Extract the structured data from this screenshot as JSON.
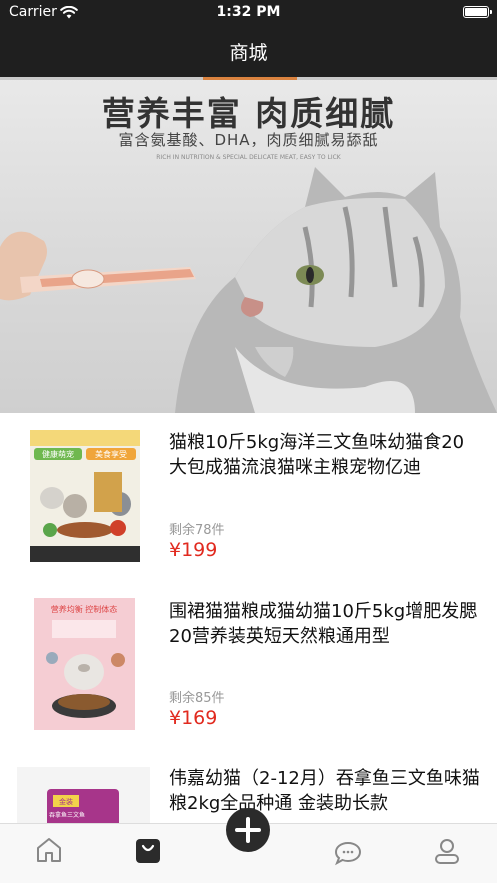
{
  "status_bar": {
    "carrier": "Carrier",
    "time": "1:32 PM"
  },
  "nav": {
    "title": "商城"
  },
  "banner": {
    "headline": "营养丰富 肉质细腻",
    "subheadline": "富含氨基酸、DHA，肉质细腻易舔舐",
    "fine_print": "RICH IN NUTRITION & SPECIAL DELICATE MEAT, EASY TO LICK",
    "pager": {
      "count": 2,
      "active": 0
    }
  },
  "products": [
    {
      "name": "猫粮10斤5kg海洋三文鱼味幼猫食20大包成猫流浪猫咪主粮宠物亿迪",
      "stock": "剩余78件",
      "price": "¥199",
      "thumb_text_1": "健康萌宠",
      "thumb_text_2": "美食享受"
    },
    {
      "name": "围裙猫猫粮成猫幼猫10斤5kg增肥发腮20营养装英短天然粮通用型",
      "stock": "剩余85件",
      "price": "¥169",
      "thumb_text_1": "营养均衡 控制体态"
    },
    {
      "name": "伟嘉幼猫（2-12月）吞拿鱼三文鱼味猫粮2kg全品种通 金装助长款",
      "thumb_text_1": "金装",
      "thumb_text_2": "吞拿鱼三文鱼"
    }
  ],
  "tabbar": {
    "tabs": [
      {
        "icon": "home-icon",
        "active": false
      },
      {
        "icon": "shop-bag-icon",
        "active": true
      },
      {
        "icon": "plus-icon"
      },
      {
        "icon": "chat-bubble-icon",
        "active": false
      },
      {
        "icon": "user-icon",
        "active": false
      }
    ]
  },
  "colors": {
    "nav_bg": "#1f1f1f",
    "price": "#e12a1f",
    "muted": "#999999"
  }
}
